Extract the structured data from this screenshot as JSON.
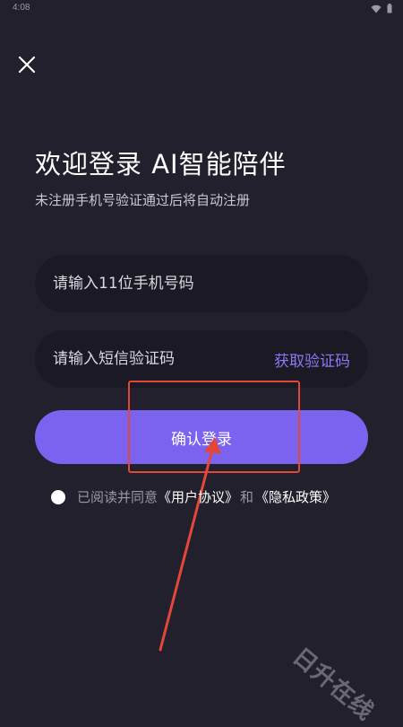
{
  "status_bar": {
    "time": "4:08",
    "icons": [
      "wifi-icon",
      "battery-icon"
    ]
  },
  "header": {
    "close_icon": "close-icon"
  },
  "login": {
    "title": "欢迎登录 AI智能陪伴",
    "subtitle": "未注册手机号验证通过后将自动注册",
    "phone_placeholder": "请输入11位手机号码",
    "phone_value": "",
    "code_placeholder": "请输入短信验证码",
    "code_value": "",
    "get_code_label": "获取验证码",
    "submit_label": "确认登录"
  },
  "agreement": {
    "prefix": "已阅读并同意",
    "user_agreement": "《用户协议》",
    "and": "和",
    "privacy_policy": "《隐私政策》",
    "checked": false
  },
  "watermark": {
    "text": "日升在线"
  },
  "colors": {
    "background": "#21202c",
    "field_background": "#1a1924",
    "accent": "#7b63f0",
    "link_accent": "#8c78f2",
    "annotation": "#e2473a"
  }
}
